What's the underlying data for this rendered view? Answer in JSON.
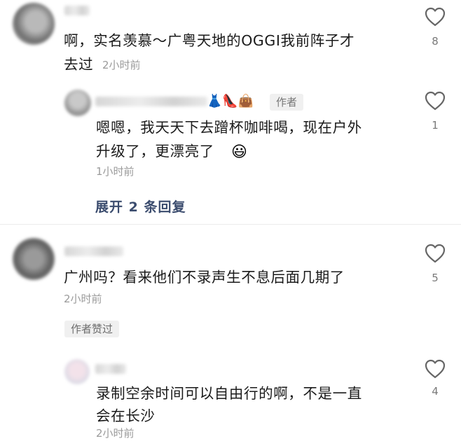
{
  "comments": [
    {
      "text_line1": "啊，实名羡慕～广粤天地的OGGI我前阵子才",
      "text_line2": "去过",
      "time": "2小时前",
      "likes": "8"
    },
    {
      "author_tag": "作者",
      "name_emojis": "👗👠👜",
      "text_line1": "嗯嗯，我天天下去蹭杯咖啡喝，现在户外",
      "text_line2": "升级了，更漂亮了",
      "emoji": "😃",
      "time": "1小时前",
      "likes": "1"
    },
    {
      "expand_label": "展开 2 条回复"
    },
    {
      "text_line1": "广州吗？看来他们不录声生不息后面几期了",
      "time": "2小时前",
      "likes": "5",
      "badge": "作者赞过"
    },
    {
      "text_line1": "录制空余时间可以自由行的啊，不是一直",
      "text_line2": "会在长沙",
      "time": "2小时前",
      "likes": "4"
    }
  ],
  "icons": {
    "like": "heart-outline-icon"
  },
  "colors": {
    "text": "#1a1a1a",
    "meta": "#9b9b9b",
    "link": "#3b4c6e",
    "tag_bg": "#f0f0f0"
  }
}
